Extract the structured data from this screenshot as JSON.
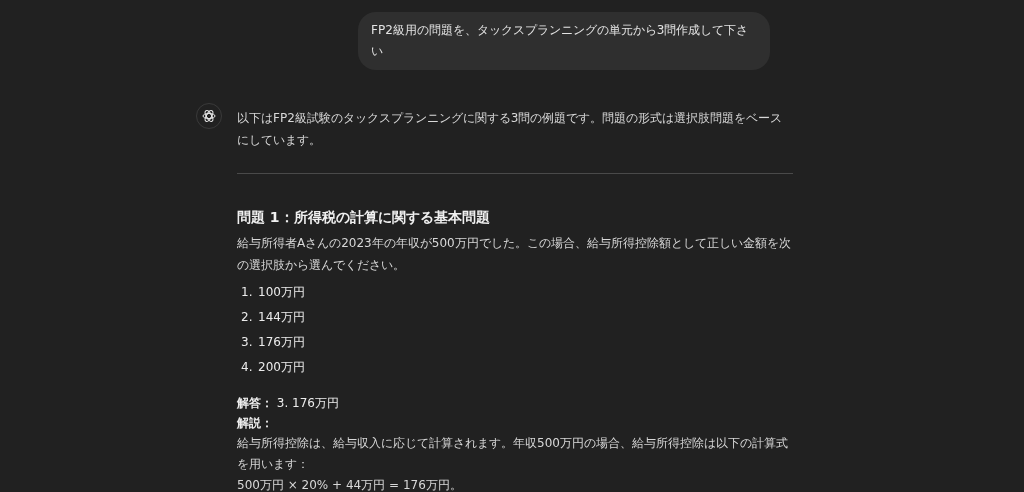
{
  "user_message": "FP2級用の問題を、タックスプランニングの単元から3問作成して下さい",
  "assistant": {
    "intro": "以下はFP2級試験のタックスプランニングに関する3問の例題です。問題の形式は選択肢問題をベースにしています。",
    "heading": "問題 1：所得税の計算に関する基本問題",
    "question": "給与所得者Aさんの2023年の年収が500万円でした。この場合、給与所得控除額として正しい金額を次の選択肢から選んでください。",
    "choices": [
      {
        "number": "1.",
        "text": "100万円"
      },
      {
        "number": "2.",
        "text": "144万円"
      },
      {
        "number": "3.",
        "text": "176万円"
      },
      {
        "number": "4.",
        "text": "200万円"
      }
    ],
    "answer": "**解答：** 3. 176万円",
    "explanation_label": "解説：",
    "explanation": "給与所得控除は、給与収入に応じて計算されます。年収500万円の場合、給与所得控除は以下の計算式を用います：",
    "formula": "500万円 × 20% + 44万円 = 176万円。"
  }
}
